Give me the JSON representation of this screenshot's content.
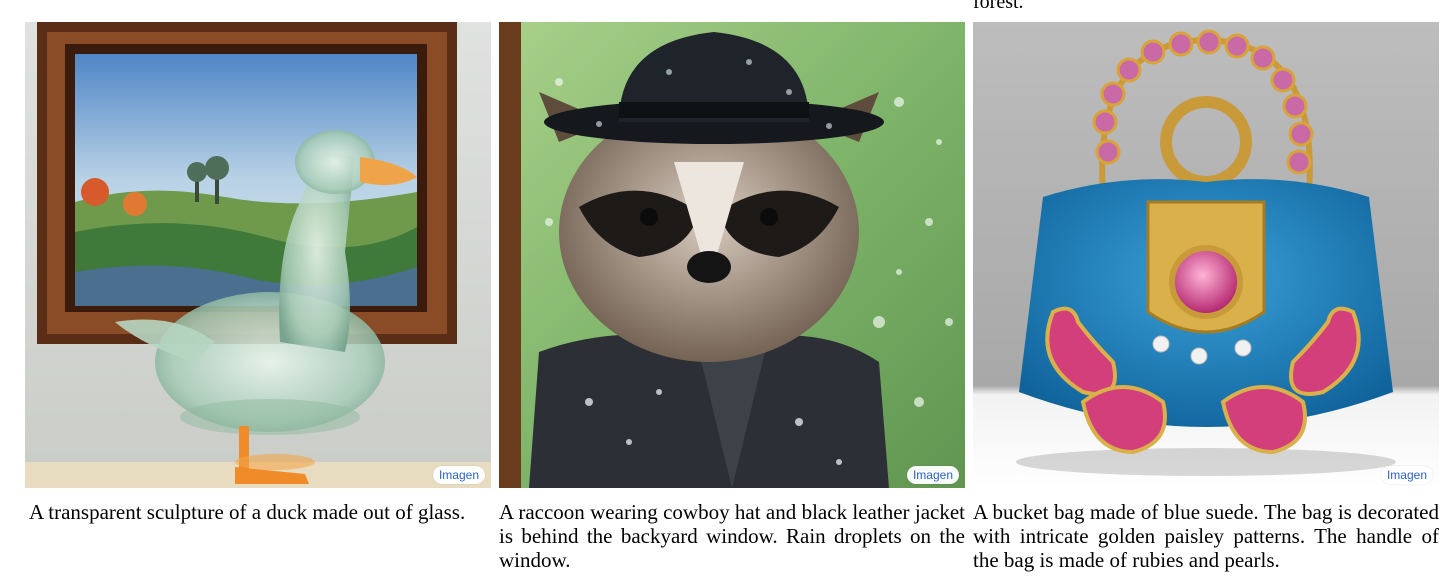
{
  "top_fragment": "forest.",
  "figures": [
    {
      "badge": "Imagen",
      "caption": "A transparent sculpture of a duck made out of glass."
    },
    {
      "badge": "Imagen",
      "caption": "A raccoon wearing cowboy hat and black leather jacket is behind the backyard window. Rain droplets on the window."
    },
    {
      "badge": "Imagen",
      "caption": "A bucket bag made of blue suede. The bag is decorated with intricate golden paisley patterns. The handle of the bag is made of rubies and pearls."
    }
  ]
}
